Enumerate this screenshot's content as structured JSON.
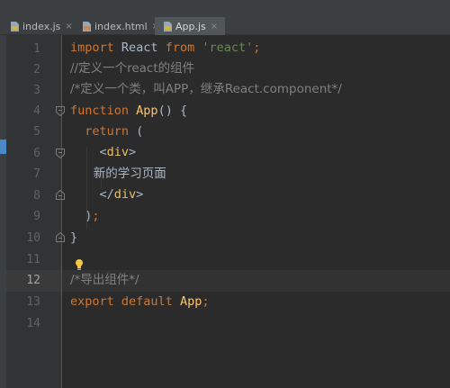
{
  "tabs": [
    {
      "label": "index.js",
      "active": false,
      "icon": "js-file-icon"
    },
    {
      "label": "index.html",
      "active": false,
      "icon": "html-file-icon"
    },
    {
      "label": "App.js",
      "active": true,
      "icon": "js-file-icon"
    }
  ],
  "close_glyph": "×",
  "current_line": 12,
  "line_numbers": [
    "1",
    "2",
    "3",
    "4",
    "5",
    "6",
    "7",
    "8",
    "9",
    "10",
    "11",
    "12",
    "13",
    "14"
  ],
  "code": {
    "l1": {
      "kw_import": "import",
      "react": " React ",
      "kw_from": "from",
      "sp": " ",
      "str": "'react'",
      "semi": ";"
    },
    "l2": {
      "comment": "//定义一个react的组件"
    },
    "l3": {
      "comment": "/*定义一个类，叫APP，继承React.component*/"
    },
    "l4": {
      "kw_function": "function",
      "sp": " ",
      "name": "App",
      "rest": "() {"
    },
    "l5": {
      "indent": "  ",
      "kw_return": "return",
      "rest": " ("
    },
    "l6": {
      "indent": "    ",
      "open": "<",
      "tag": "div",
      "close": ">"
    },
    "l7": {
      "indent": "      ",
      "text": "新的学习页面"
    },
    "l8": {
      "indent": "    ",
      "open": "</",
      "tag": "div",
      "close": ">"
    },
    "l9": {
      "indent": "  ",
      "paren": ")",
      "semi": ";"
    },
    "l10": {
      "brace": "}"
    },
    "l11": {
      "text": ""
    },
    "l12": {
      "comment": "/*导出组件*/"
    },
    "l13": {
      "kw_export": "export",
      "sp1": " ",
      "kw_default": "default",
      "sp2": " ",
      "name": "App",
      "semi": ";"
    },
    "l14": {
      "text": ""
    }
  },
  "colors": {
    "background": "#2b2b2b",
    "gutter": "#313335",
    "keyword": "#cc7832",
    "string": "#6a8759",
    "comment": "#808080",
    "function": "#ffc66d",
    "tag": "#e8bf6a",
    "text": "#a9b7c6"
  },
  "icons": [
    "js-file-icon",
    "html-file-icon",
    "close-icon",
    "fold-marker-icon",
    "lightbulb-icon"
  ]
}
